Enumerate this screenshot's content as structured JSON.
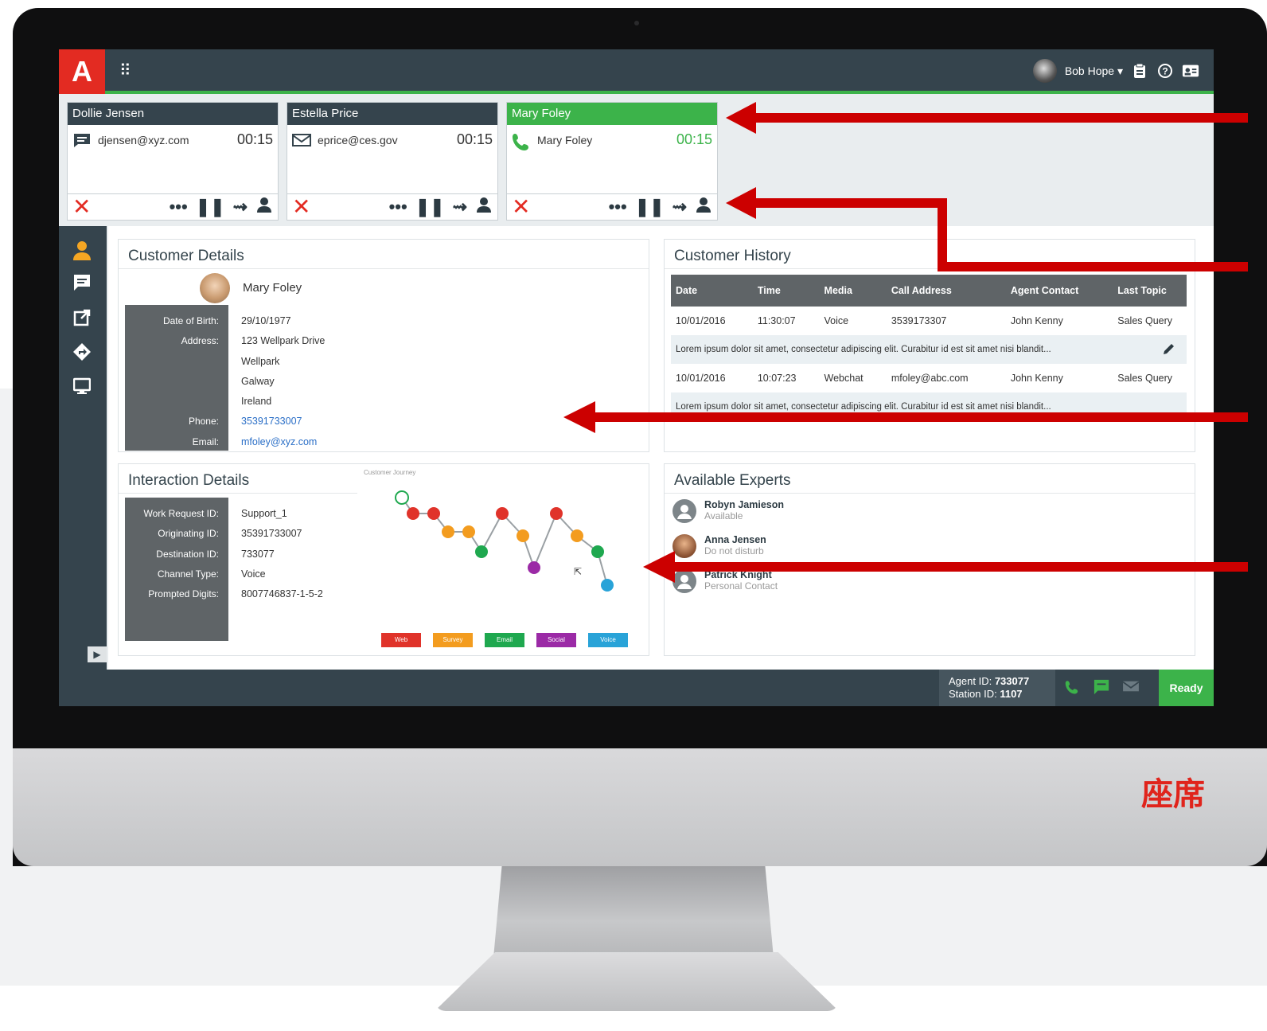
{
  "app": {
    "brand_logo": "A",
    "side_label": "座席"
  },
  "topbar": {
    "user_name": "Bob Hope ▾",
    "icons": [
      "dialpad-icon",
      "clipboard-icon",
      "help-icon",
      "contact-card-icon"
    ]
  },
  "calls": [
    {
      "name": "Dollie Jensen",
      "channel": "chat",
      "address": "djensen@xyz.com",
      "time": "00:15",
      "active": false
    },
    {
      "name": "Estella Price",
      "channel": "email",
      "address": "eprice@ces.gov",
      "time": "00:15",
      "active": false
    },
    {
      "name": "Mary Foley",
      "channel": "voice",
      "address": "Mary Foley",
      "time": "00:15",
      "active": true
    }
  ],
  "customer_details": {
    "title": "Customer Details",
    "name": "Mary Foley",
    "labels": {
      "dob": "Date of Birth:",
      "address": "Address:",
      "phone": "Phone:",
      "email": "Email:"
    },
    "dob": "29/10/1977",
    "address": [
      "123 Wellpark Drive",
      "Wellpark",
      "Galway",
      "Ireland"
    ],
    "phone": "35391733007",
    "email": "mfoley@xyz.com"
  },
  "customer_history": {
    "title": "Customer History",
    "columns": [
      "Date",
      "Time",
      "Media",
      "Call Address",
      "Agent Contact",
      "Last Topic"
    ],
    "rows": [
      {
        "date": "10/01/2016",
        "time": "11:30:07",
        "media": "Voice",
        "address": "3539173307",
        "agent": "John Kenny",
        "topic": "Sales Query",
        "note": "Lorem ipsum dolor sit amet, consectetur adipiscing elit. Curabitur id est sit amet nisi blandit..."
      },
      {
        "date": "10/01/2016",
        "time": "10:07:23",
        "media": "Webchat",
        "address": "mfoley@abc.com",
        "agent": "John Kenny",
        "topic": "Sales Query",
        "note": "Lorem ipsum dolor sit amet, consectetur adipiscing elit. Curabitur id est sit amet nisi blandit..."
      }
    ]
  },
  "interaction_details": {
    "title": "Interaction Details",
    "labels": [
      "Work Request ID:",
      "Originating ID:",
      "Destination ID:",
      "Channel Type:",
      "Prompted Digits:"
    ],
    "values": [
      "Support_1",
      "35391733007",
      "733077",
      "Voice",
      "8007746837-1-5-2"
    ]
  },
  "journey": {
    "title": "Customer Journey",
    "legend": [
      {
        "label": "Web",
        "color": "#e0332a"
      },
      {
        "label": "Survey",
        "color": "#f39c1f"
      },
      {
        "label": "Email",
        "color": "#1fa84f"
      },
      {
        "label": "Social",
        "color": "#9b2aa6"
      },
      {
        "label": "Voice",
        "color": "#29a3d8"
      }
    ],
    "points": [
      "start",
      "web",
      "web",
      "survey",
      "survey",
      "email",
      "web",
      "survey",
      "social",
      "web",
      "survey",
      "email",
      "voice"
    ]
  },
  "experts": {
    "title": "Available Experts",
    "list": [
      {
        "name": "Robyn Jamieson",
        "status": "Available"
      },
      {
        "name": "Anna Jensen",
        "status": "Do not disturb"
      },
      {
        "name": "Patrick Knight",
        "status": "Personal Contact"
      }
    ]
  },
  "statusbar": {
    "agent_label": "Agent ID:",
    "agent_id": "733077",
    "station_label": "Station ID:",
    "station_id": "1107",
    "ready": "Ready"
  }
}
